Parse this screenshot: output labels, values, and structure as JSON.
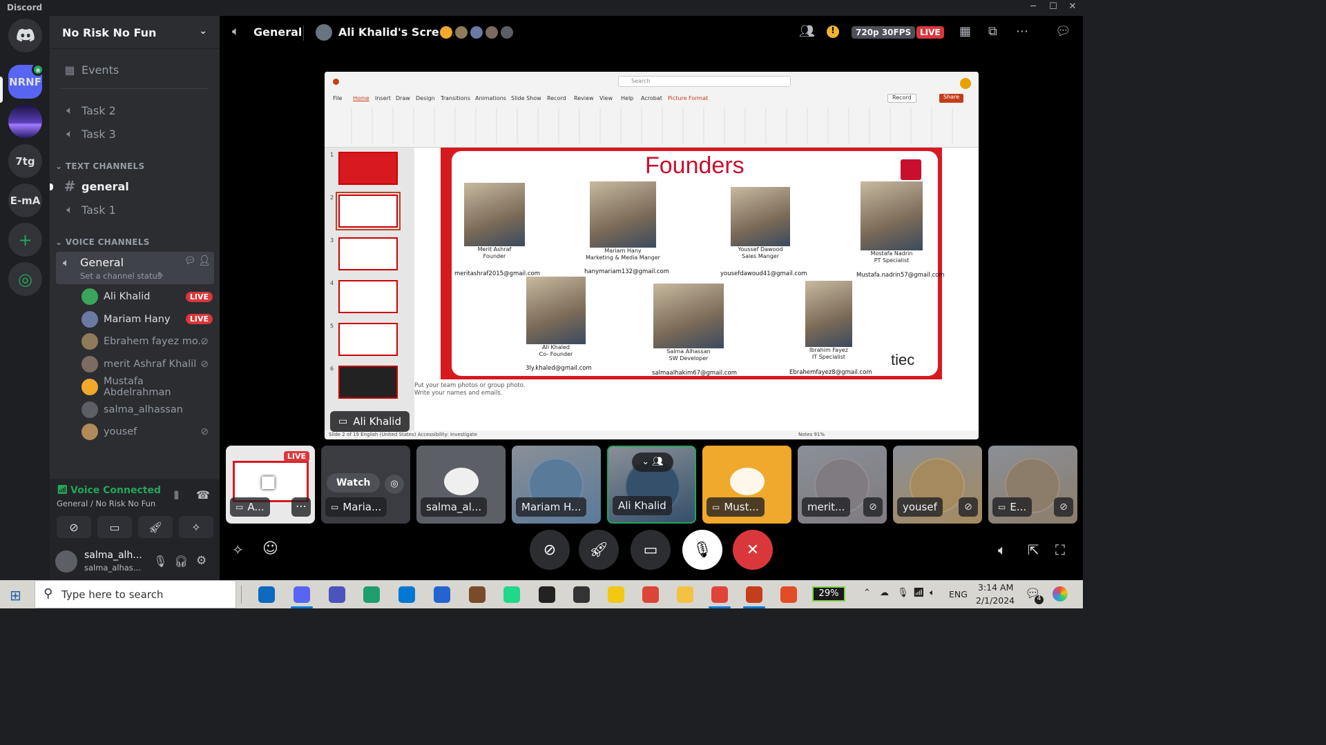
{
  "app": {
    "title": "Discord",
    "window_controls": [
      "─",
      "☐",
      "✕"
    ]
  },
  "servers": [
    {
      "label": "NRNF",
      "color": "#5865f2"
    },
    {
      "label": "",
      "color": "#3b2b6e"
    },
    {
      "label": "7tg",
      "color": "#313338"
    },
    {
      "label": "E-mA",
      "color": "#313338"
    },
    {
      "label": "+",
      "color": "#313338"
    },
    {
      "label": "◎",
      "color": "#313338"
    }
  ],
  "sidebar": {
    "server_name": "No Risk No Fun",
    "events": "Events",
    "channels_top": [
      "Task 2",
      "Task 3"
    ],
    "text_category": "TEXT CHANNELS",
    "text_channels": [
      "general",
      "Task 1"
    ],
    "voice_category": "VOICE CHANNELS",
    "voice_channel": {
      "name": "General",
      "status": "Set a channel status"
    },
    "voice_users": [
      {
        "name": "Ali Khalid",
        "live": "LIVE",
        "muted": false,
        "color": "#3ba55c"
      },
      {
        "name": "Mariam Hany",
        "live": "LIVE",
        "muted": false,
        "color": "#6b7aa3"
      },
      {
        "name": "Ebrahem fayez mo...",
        "live": "",
        "muted": true,
        "color": "#8d7b5a"
      },
      {
        "name": "merit Ashraf Khalil",
        "live": "",
        "muted": true,
        "color": "#7c6b62"
      },
      {
        "name": "Mustafa Abdelrahman",
        "live": "",
        "muted": false,
        "color": "#f0a92c"
      },
      {
        "name": "salma_alhassan",
        "live": "",
        "muted": false,
        "color": "#5c5f66"
      },
      {
        "name": "yousef",
        "live": "",
        "muted": true,
        "color": "#b08a58"
      }
    ],
    "voice_connected": "Voice Connected",
    "voice_location": "General / No Risk No Fun",
    "user": {
      "name": "salma_alh...",
      "tag": "salma_alhas..."
    }
  },
  "topbar": {
    "channel": "General",
    "screen": "Ali Khalid's Screen",
    "quality": "720p 30FPS",
    "live": "LIVE"
  },
  "stream": {
    "presenter": "Ali Khalid",
    "ppt": {
      "tabs": [
        "File",
        "Home",
        "Insert",
        "Draw",
        "Design",
        "Transitions",
        "Animations",
        "Slide Show",
        "Record",
        "Review",
        "View",
        "Help",
        "Acrobat",
        "Picture Format"
      ],
      "record_label": "Record",
      "share_label": "Share",
      "search_placeholder": "Search",
      "slide_title": "Founders",
      "founders": [
        {
          "name": "Merit Ashraf",
          "role": "Founder",
          "email": "meritashraf2015@gmail.com"
        },
        {
          "name": "Mariam Hany",
          "role": "Marketing & Media Manger",
          "email": "hanymariam132@gmail.com"
        },
        {
          "name": "Youssef  Dawood",
          "role": "Sales Manger",
          "email": "yousefdawoud41@gmail.com"
        },
        {
          "name": "Mostafa Nadrin",
          "role": "PT Specialist",
          "email": "Mustafa.nadrin57@gmail.com"
        },
        {
          "name": "Ali Khaled",
          "role": "Co- Founder",
          "email": "3ly.khaled@gmail.com"
        },
        {
          "name": "Salma Alhassan",
          "role": "SW Developer",
          "email": "salmaalhakim67@gmail.com"
        },
        {
          "name": "Ibrahim Fayez",
          "role": "IT Specialist",
          "email": "Ebrahemfayez8@gmail.com"
        }
      ],
      "logo": "tiec",
      "notes": [
        "Put your team photos or group photo.",
        "Write your names and emails."
      ],
      "status_left": "Slide 2 of 19    English (United States)    Accessibility: Investigate",
      "status_right": "Notes    91%",
      "thumb_numbers": [
        "1",
        "2",
        "3",
        "4",
        "5",
        "6"
      ]
    }
  },
  "tiles": [
    {
      "label": "A...",
      "kind": "live",
      "live": "LIVE",
      "muted": false
    },
    {
      "label": "Maria...",
      "kind": "watch",
      "watch": "Watch",
      "muted": false
    },
    {
      "label": "salma_al...",
      "kind": "discord",
      "muted": false,
      "color": "#5c5f66"
    },
    {
      "label": "Mariam H...",
      "kind": "photo",
      "muted": false,
      "color": "#5a7a9a"
    },
    {
      "label": "Ali Khalid",
      "kind": "photo",
      "muted": false,
      "color": "#34506b"
    },
    {
      "label": "Must...",
      "kind": "discord",
      "muted": false,
      "color": "#f0a92c"
    },
    {
      "label": "merit...",
      "kind": "photo",
      "muted": true,
      "color": "#7f7b80"
    },
    {
      "label": "yousef",
      "kind": "photo",
      "muted": true,
      "color": "#a58a5f"
    },
    {
      "label": "E...",
      "kind": "photo",
      "muted": true,
      "color": "#8c7d6b"
    }
  ],
  "taskbar": {
    "search_placeholder": "Type here to search",
    "battery": "29%",
    "lang": "ENG",
    "time": "3:14 AM",
    "date": "2/1/2024",
    "notifications": "4"
  },
  "colors": {
    "accent": "#5865f2",
    "live": "#da373c",
    "connected": "#23a55a",
    "ppt_red": "#d71920"
  }
}
